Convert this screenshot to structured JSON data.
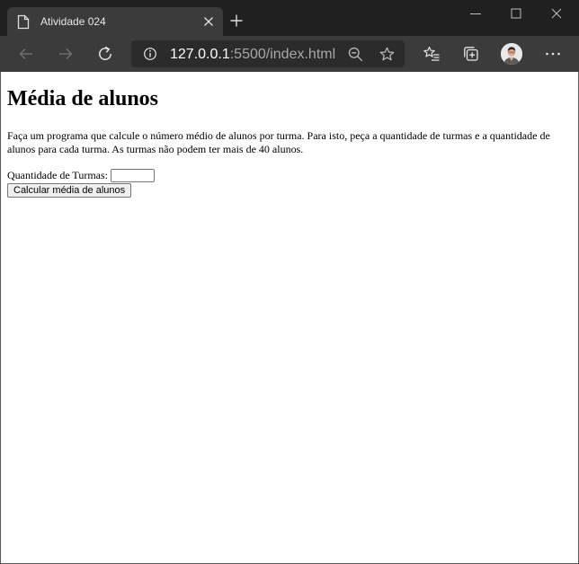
{
  "browser": {
    "tab": {
      "title": "Atividade 024"
    },
    "address_bar": {
      "host": "127.0.0.1",
      "rest": ":5500/index.html"
    },
    "icons": [
      "page-icon",
      "tab-close-icon",
      "new-tab-icon",
      "minimize-icon",
      "maximize-icon",
      "window-close-icon",
      "back-icon",
      "forward-icon",
      "refresh-icon",
      "info-icon",
      "zoom-out-icon",
      "favorite-star-icon",
      "favorites-list-icon",
      "collections-icon",
      "profile-avatar",
      "more-icon"
    ]
  },
  "page": {
    "heading": "Média de alunos",
    "description": "Faça um programa que calcule o número médio de alunos por turma. Para isto, peça a quantidade de turmas e a quantidade de alunos para cada turma. As turmas não podem ter mais de 40 alunos.",
    "form": {
      "turmas_label": "Quantidade de Turmas:",
      "turmas_value": "",
      "submit_label": "Calcular média de alunos"
    }
  }
}
